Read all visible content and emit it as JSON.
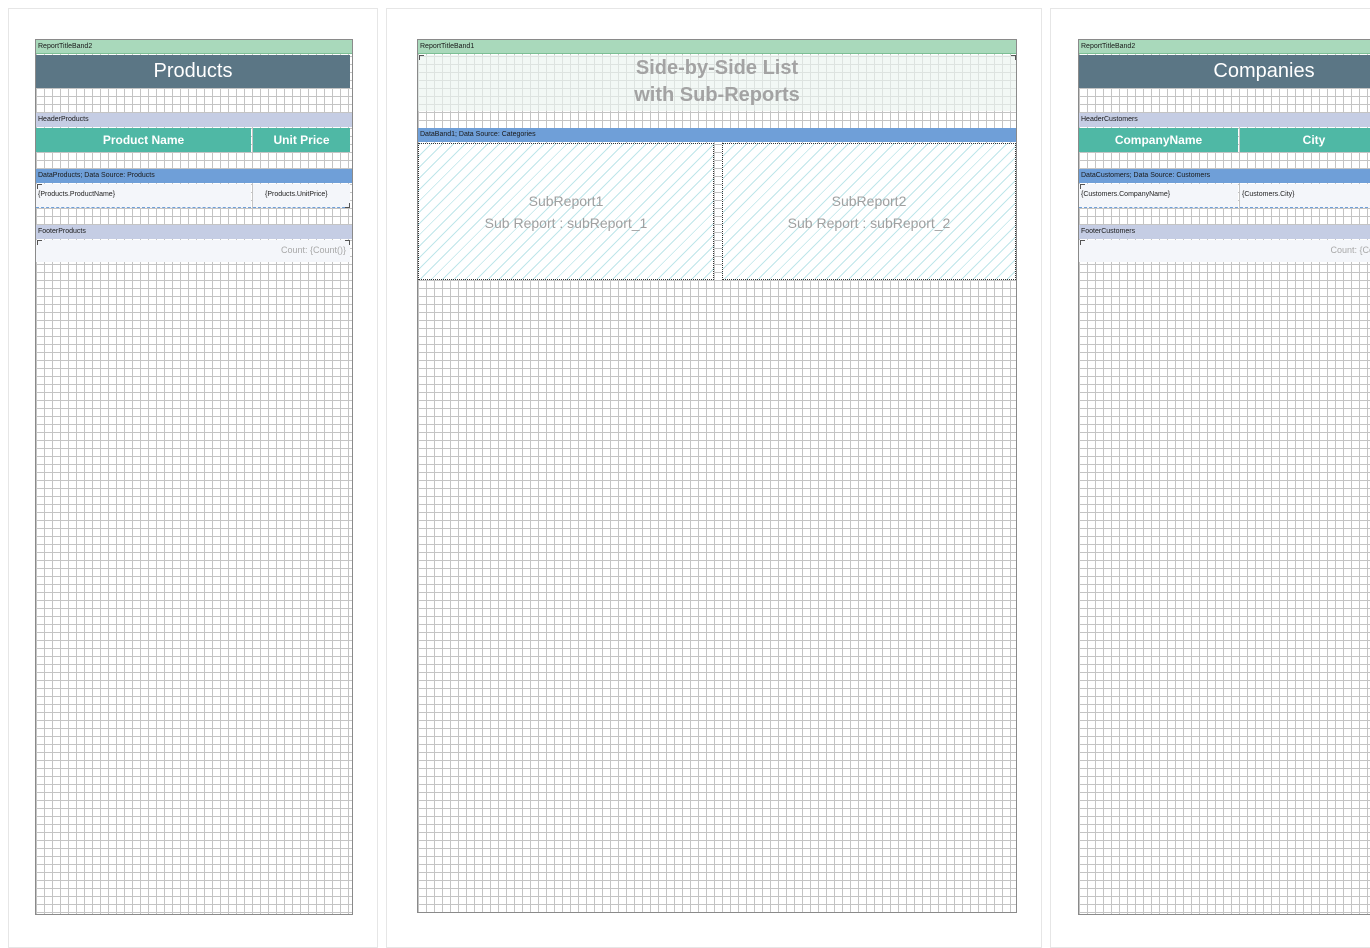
{
  "left_page": {
    "title_band": "ReportTitleBand2",
    "title": "Products",
    "header_band": "HeaderProducts",
    "columns": [
      "Product Name",
      "Unit Price"
    ],
    "data_band": "DataProducts; Data Source: Products",
    "fields": [
      "{Products.ProductName}",
      "{Products.UnitPrice}"
    ],
    "footer_band": "FooterProducts",
    "footer_text": "Count: {Count()}"
  },
  "center_page": {
    "title_band": "ReportTitleBand1",
    "title_line1": "Side-by-Side List",
    "title_line2": "with Sub-Reports",
    "data_band": "DataBand1; Data Source: Categories",
    "subreports": [
      {
        "name": "SubReport1",
        "caption": "Sub Report : subReport_1"
      },
      {
        "name": "SubReport2",
        "caption": "Sub Report : subReport_2"
      }
    ]
  },
  "right_page": {
    "title_band": "ReportTitleBand2",
    "title": "Companies",
    "header_band": "HeaderCustomers",
    "columns": [
      "CompanyName",
      "City"
    ],
    "data_band": "DataCustomers; Data Source: Customers",
    "fields": [
      "{Customers.CompanyName}",
      "{Customers.City}"
    ],
    "footer_band": "FooterCustomers",
    "footer_text": "Count: {Cou"
  },
  "colors": {
    "band_green": "#a9d9bb",
    "title_slate": "#5b7685",
    "header_teal": "#4fb8a5",
    "band_lavender": "#c5cde4",
    "band_blue": "#6f9fd8",
    "subreport_hatch": "#bfe6ea"
  }
}
